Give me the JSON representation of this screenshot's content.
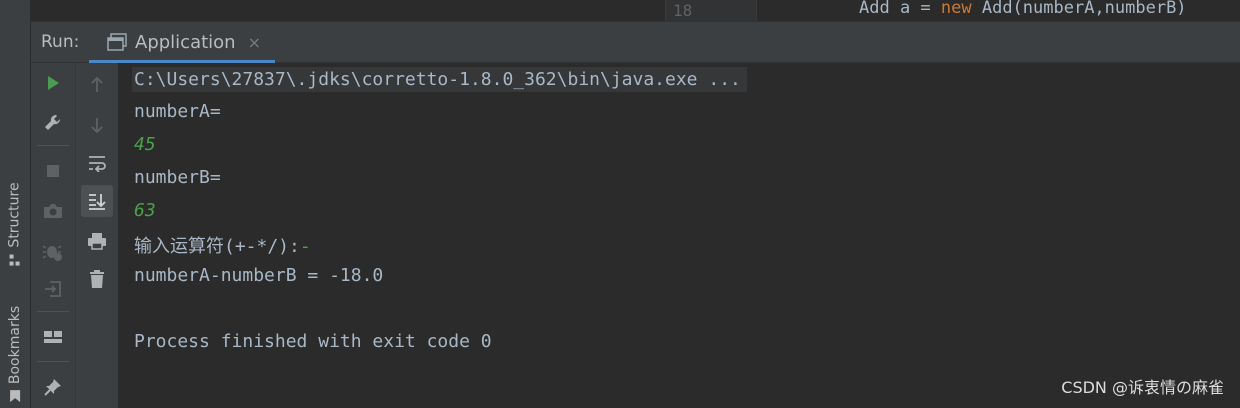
{
  "editor": {
    "line_number": "18",
    "code": {
      "pre": "Add a = ",
      "keyword": "new",
      "post": " Add(numberA,numberB)"
    }
  },
  "side_panel": {
    "structure_label": "Structure",
    "bookmarks_label": "Bookmarks"
  },
  "run_panel": {
    "label": "Run:",
    "tab_label": "Application",
    "tab_close": "×"
  },
  "toolbar": {
    "icons": [
      "rerun-icon",
      "wrench-icon",
      "stop-icon",
      "camera-icon",
      "debug-bug-icon",
      "exit-icon",
      "layout-icon",
      "pin-icon",
      "arrow-up-icon",
      "arrow-down-icon",
      "soft-wrap-icon",
      "scroll-to-end-icon",
      "print-icon",
      "trash-icon"
    ]
  },
  "console": {
    "command": "C:\\Users\\27837\\.jdks\\corretto-1.8.0_362\\bin\\java.exe ...",
    "line1": "numberA=",
    "input1": "45",
    "line2": "numberB=",
    "input2": "63",
    "prompt_text": "输入运算符",
    "prompt_symbols": "(+-*/):",
    "prompt_input": "-",
    "result": "numberA-numberB = -18.0",
    "finished": "Process finished with exit code 0"
  },
  "watermark": "CSDN @诉衷情の麻雀",
  "colors": {
    "background": "#2b2b2b",
    "panel": "#3c3f41",
    "text": "#a9b7c6",
    "user_input": "#4aa24a",
    "keyword": "#cc7832",
    "accent": "#4a88c7",
    "run_green": "#499c54"
  }
}
